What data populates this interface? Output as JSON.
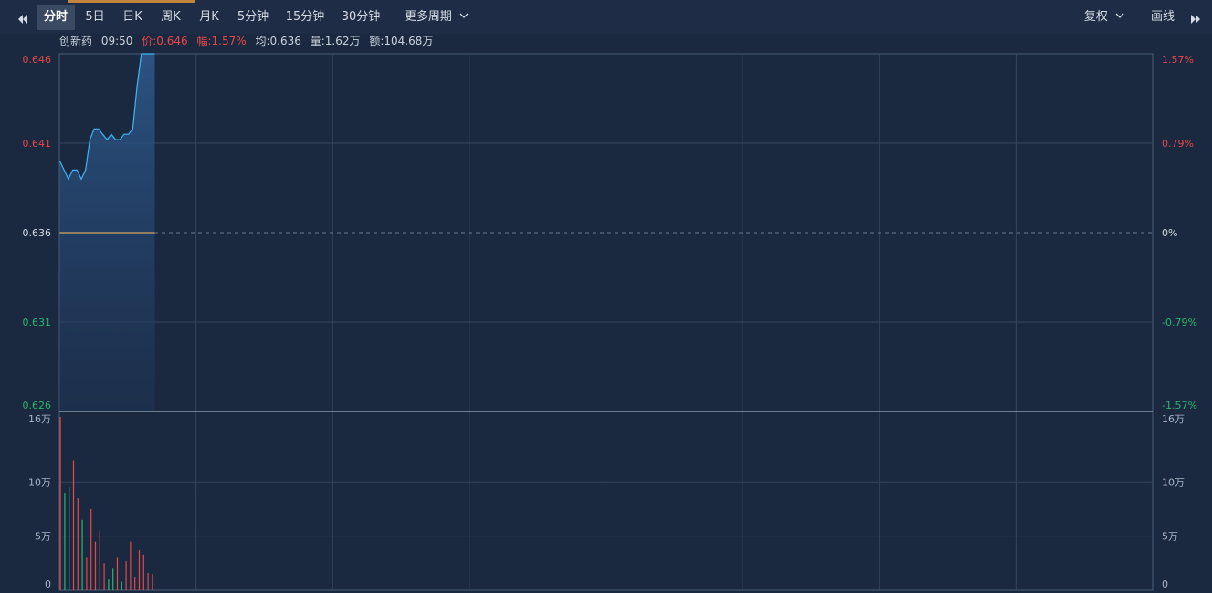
{
  "toolbar": {
    "prev_icon": "double-left-arrow-icon",
    "next_icon": "double-right-arrow-icon",
    "periods": [
      "分时",
      "5日",
      "日K",
      "周K",
      "月K",
      "5分钟",
      "15分钟",
      "30分钟"
    ],
    "more_label": "更多周期",
    "adjust_label": "复权",
    "draw_label": "画线",
    "active_period": "分时"
  },
  "info": {
    "name": "创新药",
    "time": "09:50",
    "price": "价:0.646",
    "change": "幅:1.57%",
    "avg": "均:0.636",
    "volume": "量:1.62万",
    "amount": "额:104.68万"
  },
  "colors": {
    "background": "#1b2940",
    "up": "#e54848",
    "down": "#2cb56d",
    "price_line": "#3fb5f5",
    "avg_line": "#d6a55c",
    "grid": "#34465f"
  },
  "chart_data": [
    {
      "type": "line",
      "yticks_left": [
        "0.646",
        "0.641",
        "0.636",
        "0.631",
        "0.626"
      ],
      "yticks_right": [
        "1.57%",
        "0.79%",
        "0%",
        "-0.79%",
        "-1.57%"
      ],
      "ylim": [
        0.626,
        0.646
      ],
      "base": 0.636,
      "x_slots": 240,
      "series": [
        {
          "values": [
            0.64,
            0.6395,
            0.639,
            0.6395,
            0.6395,
            0.639,
            0.6395,
            0.6412,
            0.6418,
            0.6418,
            0.6415,
            0.6412,
            0.6415,
            0.6412,
            0.6412,
            0.6415,
            0.6415,
            0.6418,
            0.6442,
            0.646,
            0.646
          ]
        },
        {
          "values": [
            0.636,
            0.636,
            0.636,
            0.636,
            0.636,
            0.636,
            0.636,
            0.636,
            0.636,
            0.636,
            0.636,
            0.636,
            0.636,
            0.636,
            0.636,
            0.636,
            0.636,
            0.636,
            0.636,
            0.636,
            0.636
          ]
        }
      ]
    },
    {
      "type": "bar",
      "yticks": [
        "16万",
        "10万",
        "5万",
        "0"
      ],
      "ylim": [
        0,
        16
      ],
      "unit": "万",
      "values": [
        16,
        9,
        9.5,
        12,
        8.5,
        6.5,
        3,
        7.5,
        4.5,
        5.5,
        2.5,
        1,
        2,
        3,
        0.8,
        2.7,
        4.5,
        1.2,
        3.7,
        3.3,
        1.6,
        1.5
      ],
      "directions": [
        "up",
        "down",
        "down",
        "up",
        "up",
        "down",
        "up",
        "up",
        "up",
        "up",
        "up",
        "down",
        "down",
        "up",
        "down",
        "up",
        "up",
        "up",
        "up",
        "up",
        "up",
        "up"
      ]
    }
  ]
}
